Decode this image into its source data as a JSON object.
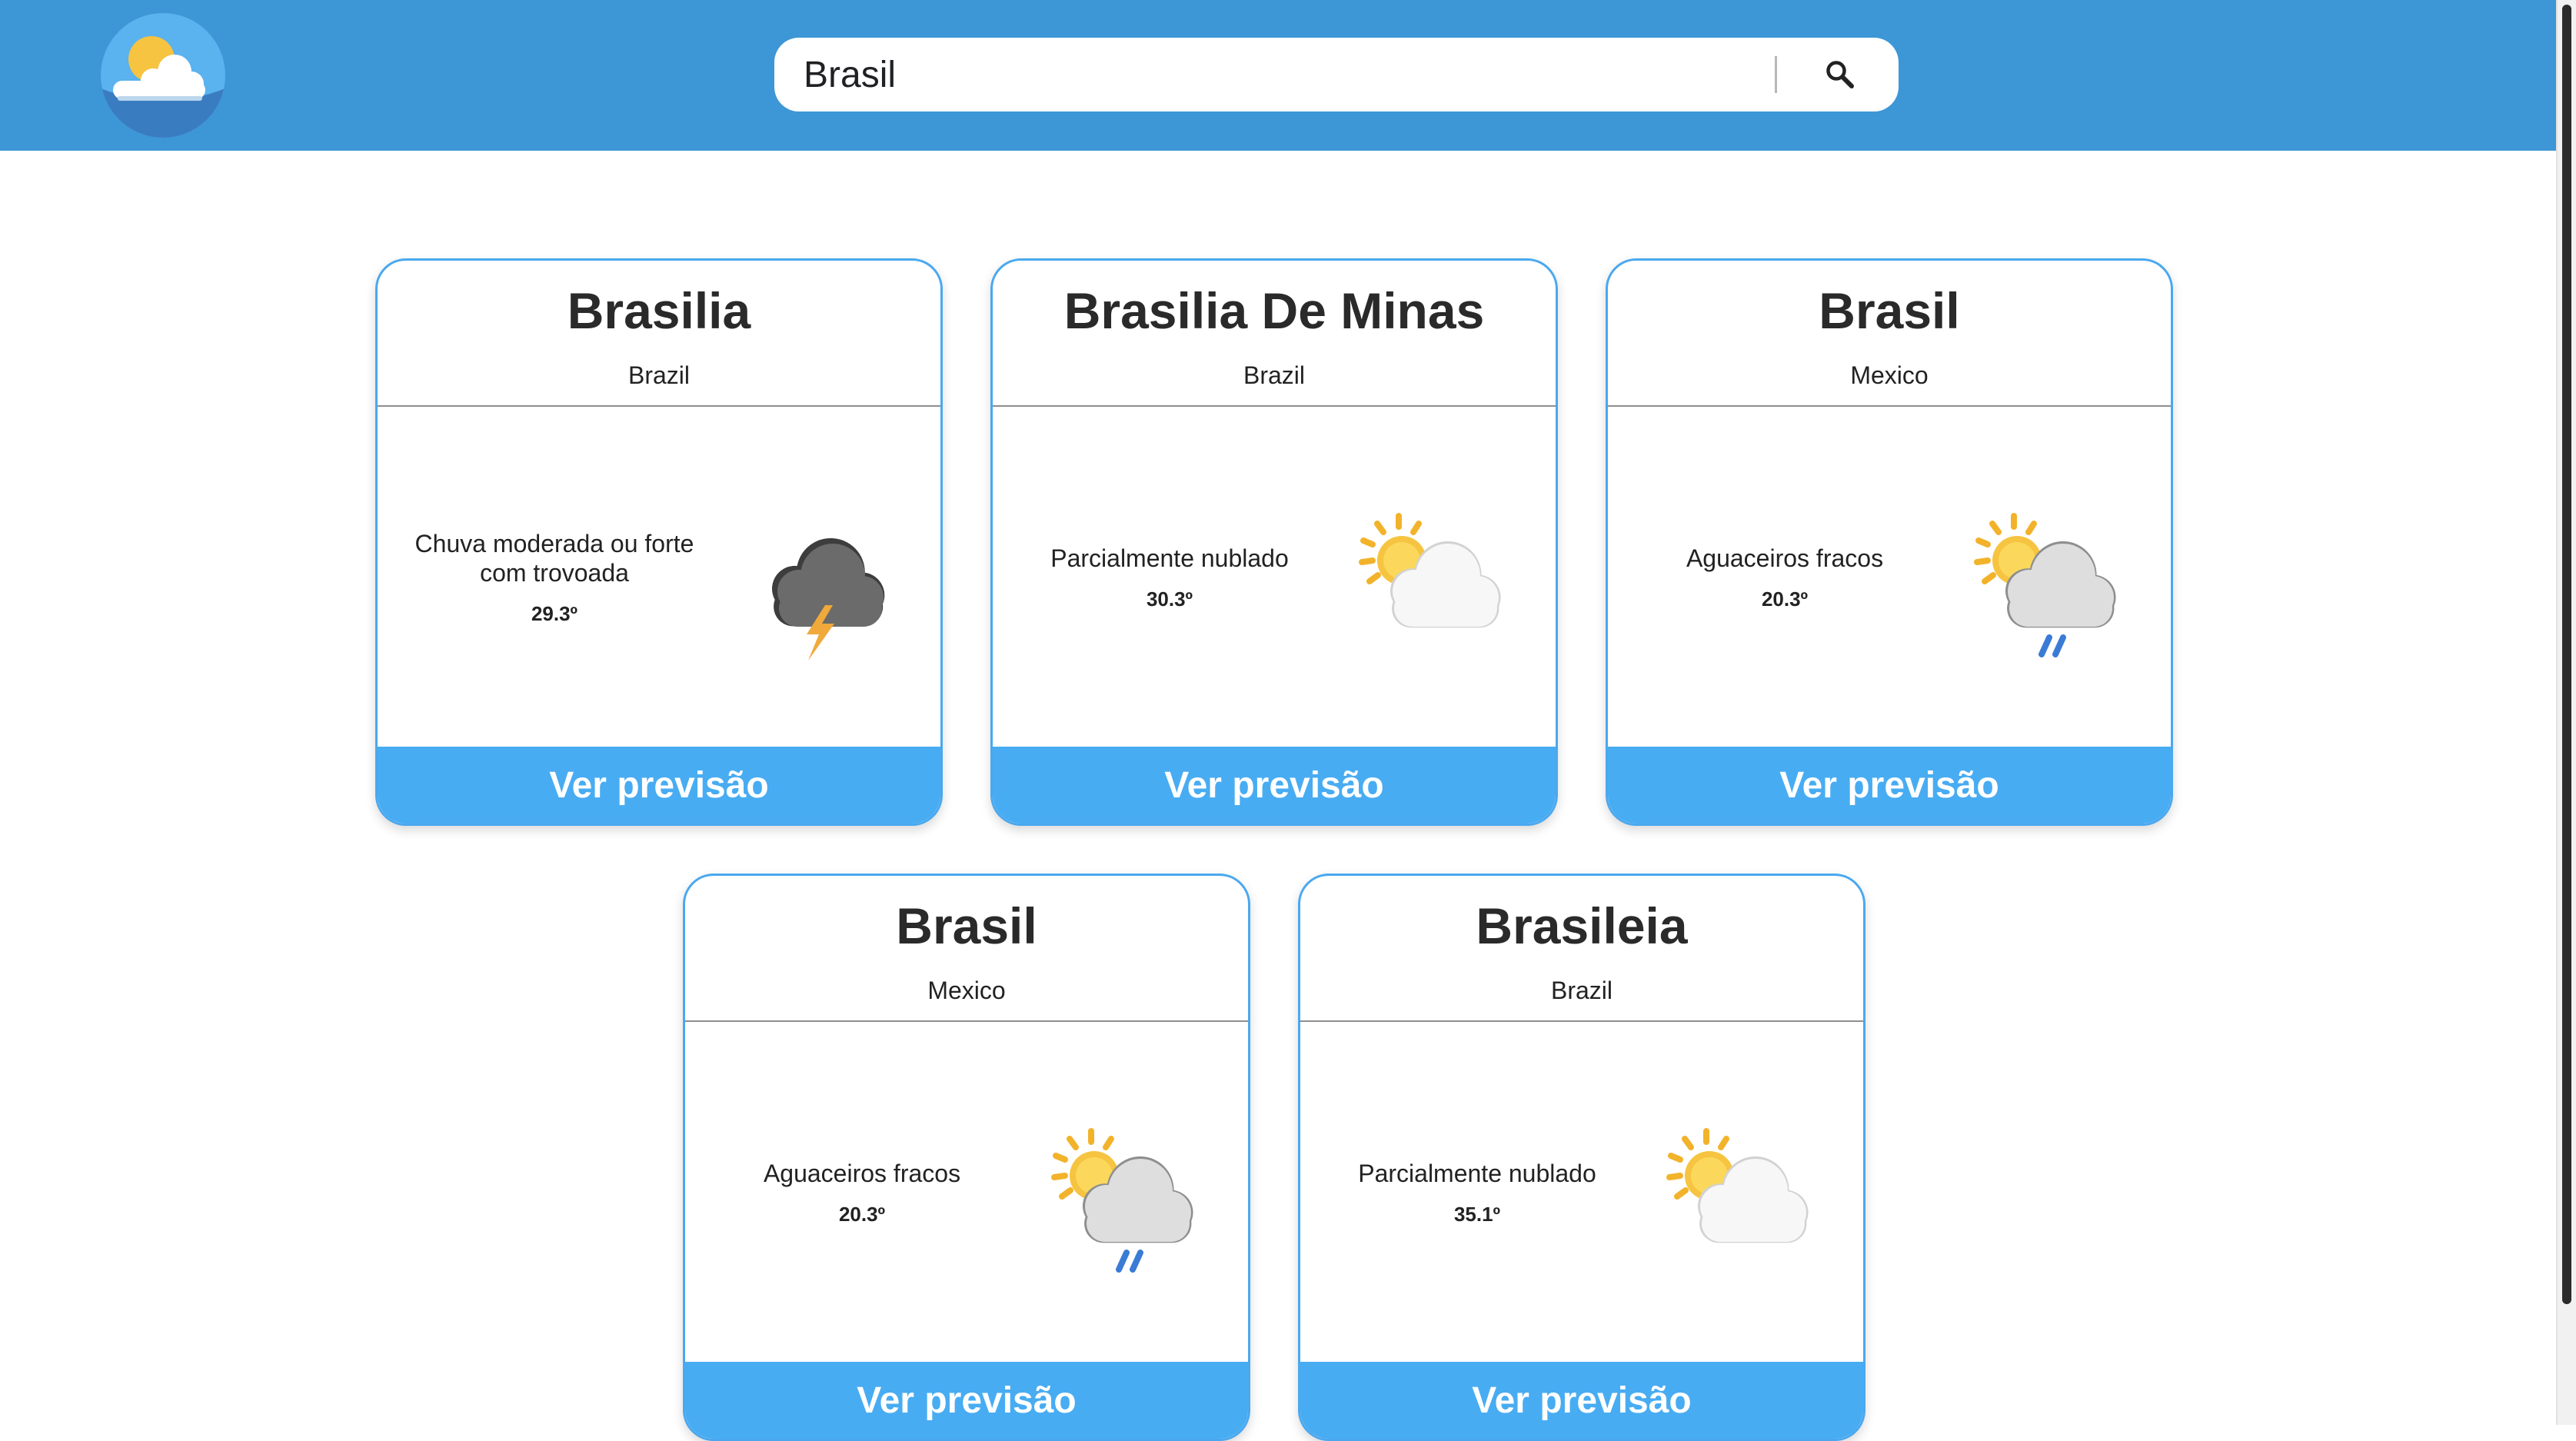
{
  "search": {
    "value": "Brasil"
  },
  "icons": {
    "logo": "sun-behind-cloud-logo",
    "search": "magnifier-icon",
    "storm": "thunder-cloud-icon",
    "partly_cloudy": "sun-behind-cloud-icon",
    "showers": "sun-cloud-rain-icon"
  },
  "colors": {
    "header": "#3d96d6",
    "button": "#48acf2",
    "card_border": "#4aa8ef"
  },
  "cards": [
    {
      "city": "Brasilia",
      "country": "Brazil",
      "condition": "Chuva moderada ou forte com trovoada",
      "temp": "29.3º",
      "icon": "thunder-cloud-icon",
      "button": "Ver previsão"
    },
    {
      "city": "Brasilia De Minas",
      "country": "Brazil",
      "condition": "Parcialmente nublado",
      "temp": "30.3º",
      "icon": "sun-behind-cloud-icon",
      "button": "Ver previsão"
    },
    {
      "city": "Brasil",
      "country": "Mexico",
      "condition": "Aguaceiros fracos",
      "temp": "20.3º",
      "icon": "sun-cloud-rain-icon",
      "button": "Ver previsão"
    },
    {
      "city": "Brasil",
      "country": "Mexico",
      "condition": "Aguaceiros fracos",
      "temp": "20.3º",
      "icon": "sun-cloud-rain-icon",
      "button": "Ver previsão"
    },
    {
      "city": "Brasileia",
      "country": "Brazil",
      "condition": "Parcialmente nublado",
      "temp": "35.1º",
      "icon": "sun-behind-cloud-icon",
      "button": "Ver previsão"
    }
  ]
}
